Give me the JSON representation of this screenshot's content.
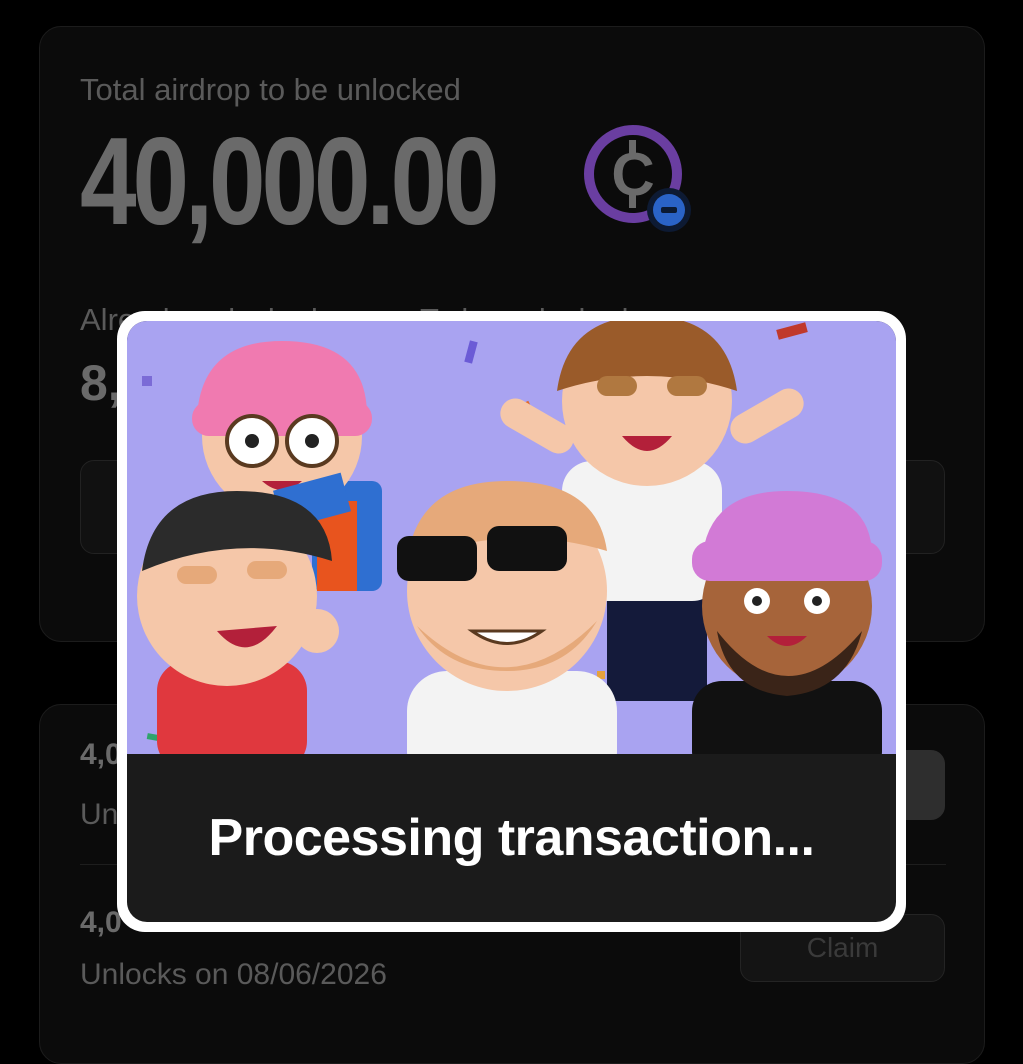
{
  "summary": {
    "total_label": "Total airdrop to be unlocked",
    "total_amount": "40,000.00",
    "token_icon": "coin-c-icon",
    "already_label": "Already unlocked",
    "to_be_label": "To be unlocked",
    "already_amount": "8,",
    "to_be_amount": ""
  },
  "unlocks": [
    {
      "amount": "4,0",
      "subtitle": "Un",
      "claim_label": ""
    },
    {
      "amount": "4,0",
      "subtitle": "Unlocks on 08/06/2026",
      "claim_label": "Claim"
    }
  ],
  "modal": {
    "illustration": "celebrating-characters-illustration",
    "message": "Processing transaction..."
  },
  "colors": {
    "background": "#000000",
    "card": "#0b0b0b",
    "token_ring": "#6a3ea1",
    "badge": "#2a63c7",
    "illustration_bg": "#a9a3f1",
    "modal_footer": "#1b1b1b"
  }
}
